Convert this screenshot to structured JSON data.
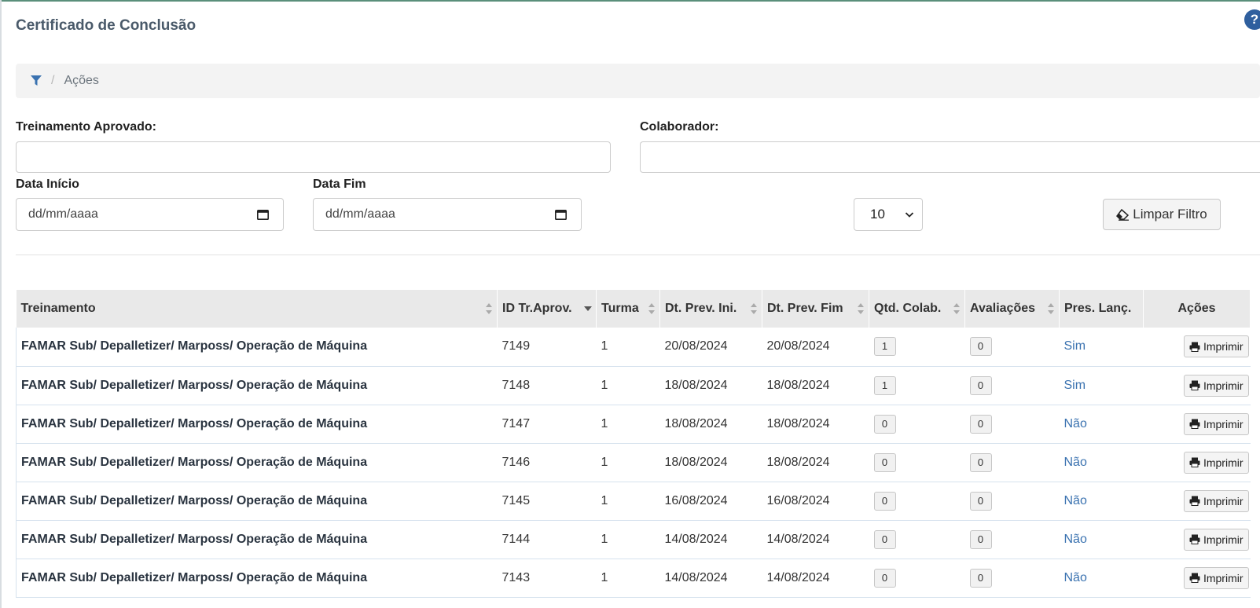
{
  "page": {
    "title": "Certificado de Conclusão",
    "help_icon": "?"
  },
  "breadcrumb": {
    "icon": "filter-icon",
    "separator": "/",
    "current": "Ações"
  },
  "filters": {
    "treinamento_label": "Treinamento Aprovado:",
    "treinamento_value": "",
    "colaborador_label": "Colaborador:",
    "colaborador_value": "",
    "data_inicio_label": "Data Início",
    "data_inicio_placeholder": "dd/mm/aaaa",
    "data_fim_label": "Data Fim",
    "data_fim_placeholder": "dd/mm/aaaa",
    "page_size": "10",
    "clear_label": "Limpar Filtro"
  },
  "table": {
    "headers": [
      "Treinamento",
      "ID Tr.Aprov.",
      "Turma",
      "Dt. Prev. Ini.",
      "Dt. Prev. Fim",
      "Qtd. Colab.",
      "Avaliações",
      "Pres. Lanç.",
      "Ações"
    ],
    "print_label": "Imprimir",
    "rows": [
      {
        "treinamento": "FAMAR Sub/ Depalletizer/ Marposs/ Operação de Máquina",
        "id": "7149",
        "turma": "1",
        "ini": "20/08/2024",
        "fim": "20/08/2024",
        "qtd": "1",
        "aval": "0",
        "pres": "Sim"
      },
      {
        "treinamento": "FAMAR Sub/ Depalletizer/ Marposs/ Operação de Máquina",
        "id": "7148",
        "turma": "1",
        "ini": "18/08/2024",
        "fim": "18/08/2024",
        "qtd": "1",
        "aval": "0",
        "pres": "Sim"
      },
      {
        "treinamento": "FAMAR Sub/ Depalletizer/ Marposs/ Operação de Máquina",
        "id": "7147",
        "turma": "1",
        "ini": "18/08/2024",
        "fim": "18/08/2024",
        "qtd": "0",
        "aval": "0",
        "pres": "Não"
      },
      {
        "treinamento": "FAMAR Sub/ Depalletizer/ Marposs/ Operação de Máquina",
        "id": "7146",
        "turma": "1",
        "ini": "18/08/2024",
        "fim": "18/08/2024",
        "qtd": "0",
        "aval": "0",
        "pres": "Não"
      },
      {
        "treinamento": "FAMAR Sub/ Depalletizer/ Marposs/ Operação de Máquina",
        "id": "7145",
        "turma": "1",
        "ini": "16/08/2024",
        "fim": "16/08/2024",
        "qtd": "0",
        "aval": "0",
        "pres": "Não"
      },
      {
        "treinamento": "FAMAR Sub/ Depalletizer/ Marposs/ Operação de Máquina",
        "id": "7144",
        "turma": "1",
        "ini": "14/08/2024",
        "fim": "14/08/2024",
        "qtd": "0",
        "aval": "0",
        "pres": "Não"
      },
      {
        "treinamento": "FAMAR Sub/ Depalletizer/ Marposs/ Operação de Máquina",
        "id": "7143",
        "turma": "1",
        "ini": "14/08/2024",
        "fim": "14/08/2024",
        "qtd": "0",
        "aval": "0",
        "pres": "Não"
      }
    ]
  },
  "colors": {
    "accent": "#3a72b0",
    "title": "#4a5a6a",
    "header_bg": "#e9e9e9"
  }
}
